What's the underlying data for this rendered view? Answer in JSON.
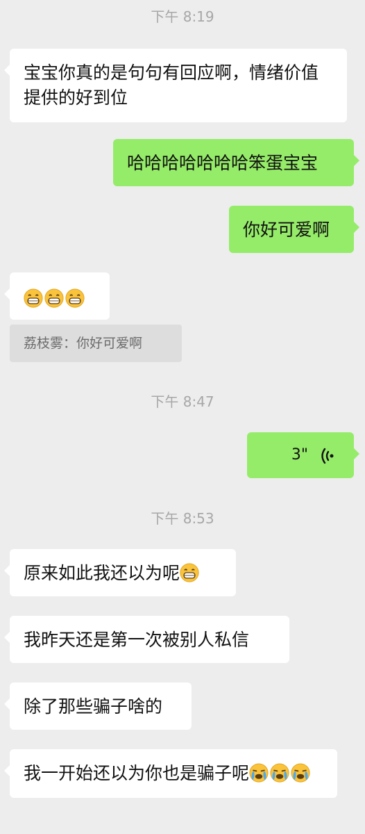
{
  "timestamps": [
    "下午 8:19",
    "下午 8:47",
    "下午 8:53"
  ],
  "messages": [
    {
      "side": "left",
      "text": "宝宝你真的是句句有回应啊，情绪价值提供的好到位"
    },
    {
      "side": "right",
      "text": "哈哈哈哈哈哈哈笨蛋宝宝"
    },
    {
      "side": "right",
      "text": "你好可爱啊"
    },
    {
      "side": "left",
      "emoji": "grinning-face-emoji",
      "emoji_count": 3
    },
    {
      "quote": "荔枝雾：你好可爱啊"
    },
    {
      "side": "right",
      "voice": true,
      "duration": "3\""
    },
    {
      "side": "left",
      "text": "原来如此我还以为呢",
      "emoji": "grinning-face-emoji"
    },
    {
      "side": "left",
      "text": "我昨天还是第一次被别人私信"
    },
    {
      "side": "left",
      "text": "除了那些骗子啥的"
    },
    {
      "side": "left",
      "text": "我一开始还以为你也是骗子呢",
      "emoji": "loudly-crying-face-emoji",
      "emoji_count": 3
    }
  ],
  "colors": {
    "background": "#ededed",
    "incoming_bubble": "#ffffff",
    "outgoing_bubble": "#95ec69",
    "quote_background": "#dddddd",
    "timestamp_text": "#a7a7a7"
  }
}
